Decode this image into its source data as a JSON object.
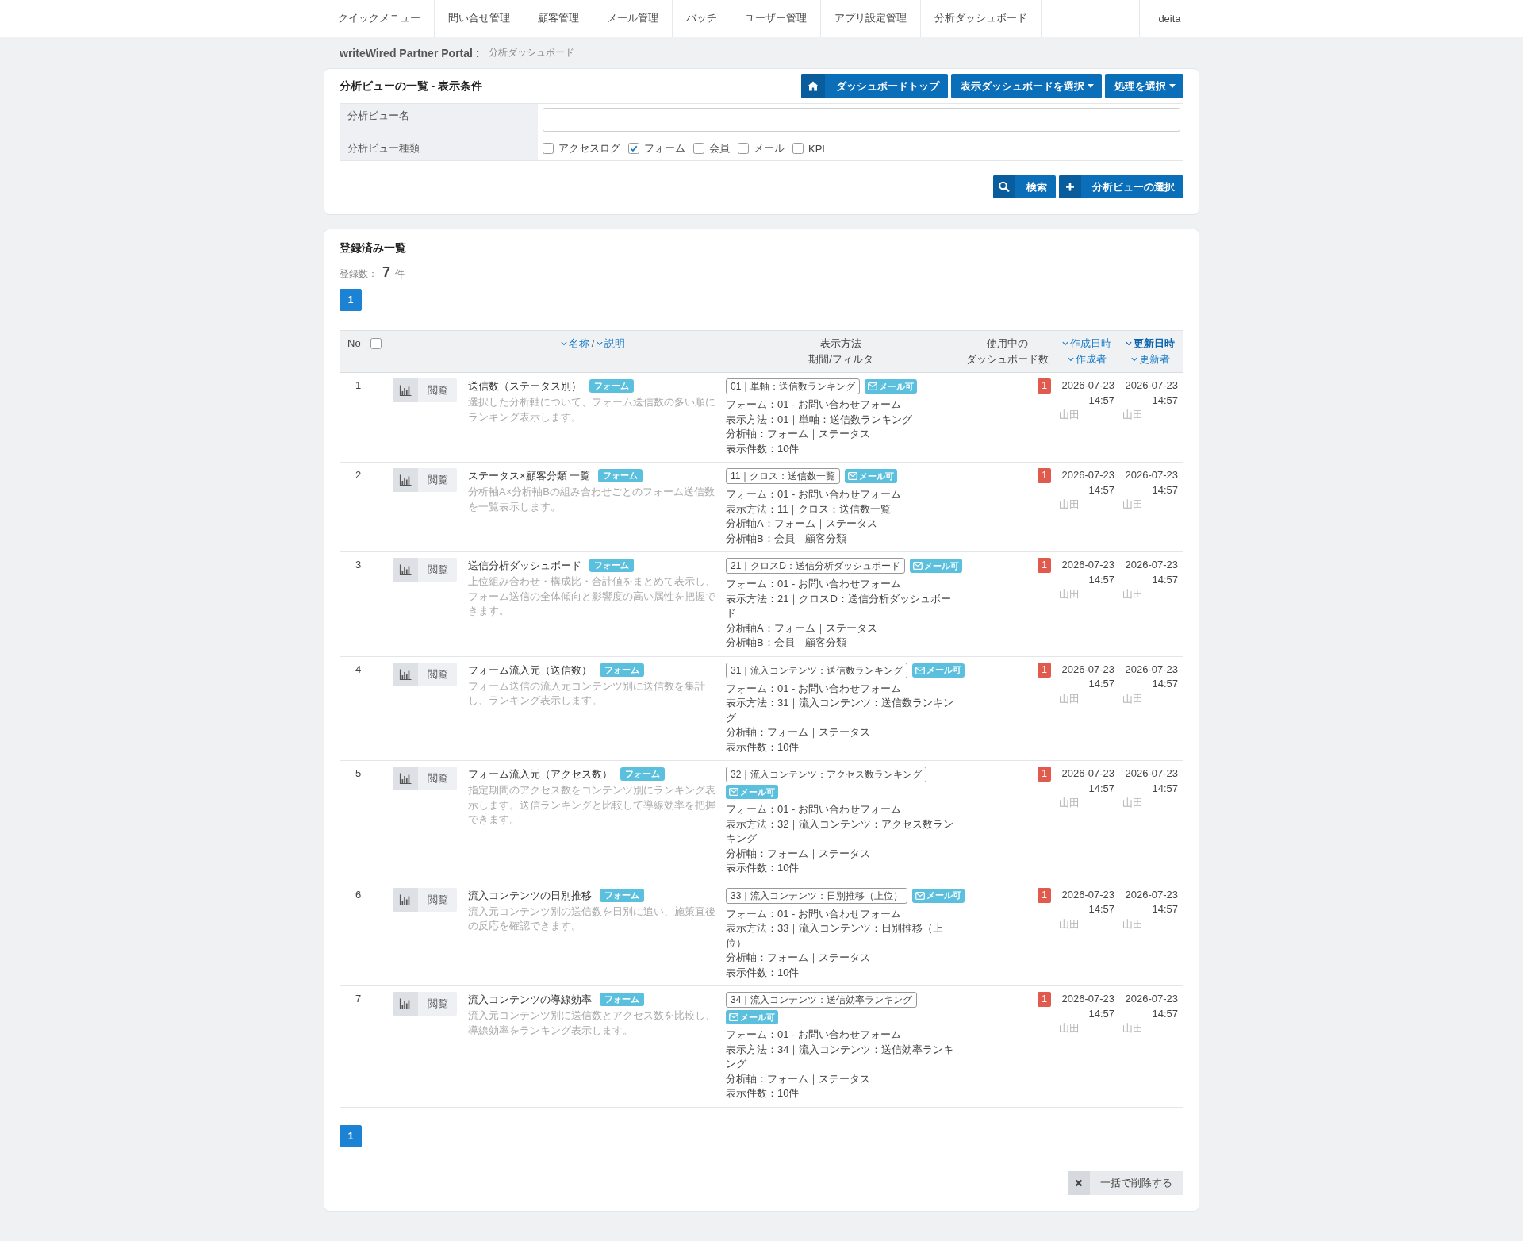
{
  "top_nav": {
    "items": [
      "クイックメニュー",
      "問い合せ管理",
      "顧客管理",
      "メール管理",
      "バッチ",
      "ユーザー管理",
      "アプリ設定管理",
      "分析ダッシュボード"
    ],
    "user": "deita"
  },
  "breadcrumb": {
    "site": "writeWired Partner Portal :",
    "page": "分析ダッシュボード"
  },
  "search_panel": {
    "title": "分析ビューの一覧 - 表示条件",
    "header_buttons": [
      {
        "kind": "home",
        "label": "ダッシュボードトップ"
      },
      {
        "kind": "dropdown",
        "label": "表示ダッシュボードを選択"
      },
      {
        "kind": "dropdown",
        "label": "処理を選択"
      }
    ],
    "fields": [
      {
        "kind": "text",
        "label": "分析ビュー名"
      },
      {
        "kind": "checkboxes",
        "label": "分析ビュー種類",
        "options": [
          {
            "label": "アクセスログ",
            "checked": false
          },
          {
            "label": "フォーム",
            "checked": true
          },
          {
            "label": "会員",
            "checked": false
          },
          {
            "label": "メール",
            "checked": false
          },
          {
            "label": "KPI",
            "checked": false
          }
        ]
      }
    ],
    "actions": [
      {
        "kind": "search",
        "label": "検索"
      },
      {
        "kind": "add",
        "label": "分析ビューの選択"
      }
    ]
  },
  "list_panel": {
    "title": "登録済み一覧",
    "count_label": "登録数：",
    "count": "7",
    "count_unit": "件",
    "pagination_top": [
      {
        "label": "1",
        "selected": true
      }
    ],
    "table": {
      "columns": [
        {
          "kind": "no",
          "label": "No",
          "checked": false
        },
        {
          "kind": "sort_pair",
          "links": [
            {
              "label": "名称",
              "selected": false
            },
            {
              "label": "説明",
              "selected": false
            }
          ],
          "separator": "/"
        },
        {
          "kind": "lines",
          "lines": [
            "表示方法",
            "期間/フィルタ"
          ]
        },
        {
          "kind": "lines",
          "lines": [
            "使用中の",
            "ダッシュボード数"
          ]
        },
        {
          "kind": "sort_stack",
          "links": [
            {
              "label": "作成日時",
              "selected": false
            },
            {
              "label": "作成者",
              "selected": false
            }
          ]
        },
        {
          "kind": "sort_stack",
          "links": [
            {
              "label": "更新日時",
              "selected": true
            },
            {
              "label": "更新者",
              "selected": false
            }
          ]
        }
      ],
      "rows": [
        {
          "no": "1",
          "view_label": "閲覧",
          "name": "送信数（ステータス別）",
          "type_tag": "フォーム",
          "description": "選択した分析軸について、フォーム送信数の多い順にランキング表示します。",
          "method_tag": "01｜単軸：送信数ランキング",
          "mail_badge": "メール可",
          "details": [
            "フォーム：01 - お問い合わせフォーム",
            "表示方法：01｜単軸：送信数ランキング",
            "分析軸：フォーム｜ステータス",
            "表示件数：10件"
          ],
          "dashboard_count": "1",
          "created": "2026-07-23 14:57",
          "created_by": "山田",
          "updated": "2026-07-23 14:57",
          "updated_by": "山田"
        },
        {
          "no": "2",
          "view_label": "閲覧",
          "name": "ステータス×顧客分類 一覧",
          "type_tag": "フォーム",
          "description": "分析軸A×分析軸Bの組み合わせごとのフォーム送信数を一覧表示します。",
          "method_tag": "11｜クロス：送信数一覧",
          "mail_badge": "メール可",
          "details": [
            "フォーム：01 - お問い合わせフォーム",
            "表示方法：11｜クロス：送信数一覧",
            "分析軸A：フォーム｜ステータス",
            "分析軸B：会員｜顧客分類"
          ],
          "dashboard_count": "1",
          "created": "2026-07-23 14:57",
          "created_by": "山田",
          "updated": "2026-07-23 14:57",
          "updated_by": "山田"
        },
        {
          "no": "3",
          "view_label": "閲覧",
          "name": "送信分析ダッシュボード",
          "type_tag": "フォーム",
          "description": "上位組み合わせ・構成比・合計値をまとめて表示し、フォーム送信の全体傾向と影響度の高い属性を把握できます。",
          "method_tag": "21｜クロスD：送信分析ダッシュボード",
          "mail_badge": "メール可",
          "details": [
            "フォーム：01 - お問い合わせフォーム",
            "表示方法：21｜クロスD：送信分析ダッシュボード",
            "分析軸A：フォーム｜ステータス",
            "分析軸B：会員｜顧客分類"
          ],
          "dashboard_count": "1",
          "created": "2026-07-23 14:57",
          "created_by": "山田",
          "updated": "2026-07-23 14:57",
          "updated_by": "山田"
        },
        {
          "no": "4",
          "view_label": "閲覧",
          "name": "フォーム流入元（送信数）",
          "type_tag": "フォーム",
          "description": "フォーム送信の流入元コンテンツ別に送信数を集計し、ランキング表示します。",
          "method_tag": "31｜流入コンテンツ：送信数ランキング",
          "mail_badge": "メール可",
          "details": [
            "フォーム：01 - お問い合わせフォーム",
            "表示方法：31｜流入コンテンツ：送信数ランキング",
            "分析軸：フォーム｜ステータス",
            "表示件数：10件"
          ],
          "dashboard_count": "1",
          "created": "2026-07-23 14:57",
          "created_by": "山田",
          "updated": "2026-07-23 14:57",
          "updated_by": "山田"
        },
        {
          "no": "5",
          "view_label": "閲覧",
          "name": "フォーム流入元（アクセス数）",
          "type_tag": "フォーム",
          "description": "指定期間のアクセス数をコンテンツ別にランキング表示します。送信ランキングと比較して導線効率を把握できます。",
          "method_tag": "32｜流入コンテンツ：アクセス数ランキング",
          "mail_badge": "メール可",
          "details": [
            "フォーム：01 - お問い合わせフォーム",
            "表示方法：32｜流入コンテンツ：アクセス数ランキング",
            "分析軸：フォーム｜ステータス",
            "表示件数：10件"
          ],
          "dashboard_count": "1",
          "created": "2026-07-23 14:57",
          "created_by": "山田",
          "updated": "2026-07-23 14:57",
          "updated_by": "山田"
        },
        {
          "no": "6",
          "view_label": "閲覧",
          "name": "流入コンテンツの日別推移",
          "type_tag": "フォーム",
          "description": "流入元コンテンツ別の送信数を日別に追い、施策直後の反応を確認できます。",
          "method_tag": "33｜流入コンテンツ：日別推移（上位）",
          "mail_badge": "メール可",
          "details": [
            "フォーム：01 - お問い合わせフォーム",
            "表示方法：33｜流入コンテンツ：日別推移（上位）",
            "分析軸：フォーム｜ステータス",
            "表示件数：10件"
          ],
          "dashboard_count": "1",
          "created": "2026-07-23 14:57",
          "created_by": "山田",
          "updated": "2026-07-23 14:57",
          "updated_by": "山田"
        },
        {
          "no": "7",
          "view_label": "閲覧",
          "name": "流入コンテンツの導線効率",
          "type_tag": "フォーム",
          "description": "流入元コンテンツ別に送信数とアクセス数を比較し、導線効率をランキング表示します。",
          "method_tag": "34｜流入コンテンツ：送信効率ランキング",
          "mail_badge": "メール可",
          "details": [
            "フォーム：01 - お問い合わせフォーム",
            "表示方法：34｜流入コンテンツ：送信効率ランキング",
            "分析軸：フォーム｜ステータス",
            "表示件数：10件"
          ],
          "dashboard_count": "1",
          "created": "2026-07-23 14:57",
          "created_by": "山田",
          "updated": "2026-07-23 14:57",
          "updated_by": "山田"
        }
      ]
    },
    "pagination_bottom": [
      {
        "label": "1",
        "selected": true
      }
    ],
    "bulk_action": {
      "kind": "delete",
      "label": "一括で削除する"
    }
  }
}
